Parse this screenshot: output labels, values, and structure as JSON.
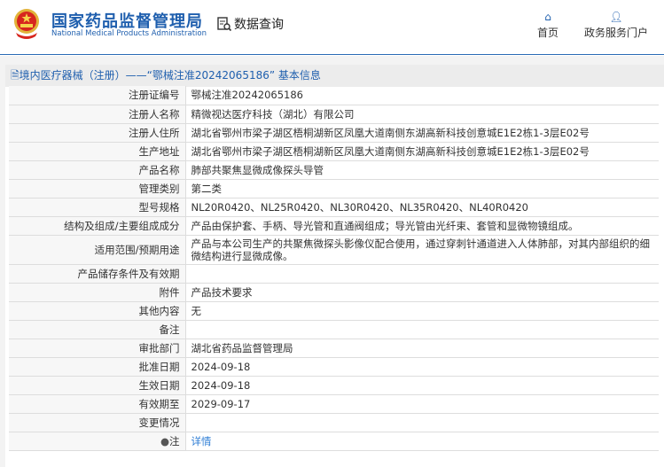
{
  "header": {
    "title_cn": "国家药品监督管理局",
    "title_en": "National Medical Products Administration",
    "query": "数据查询",
    "nav": [
      {
        "label": "首页",
        "icon": "home-icon"
      },
      {
        "label": "政务服务门户",
        "icon": "user-icon"
      }
    ]
  },
  "panel_title": "境内医疗器械（注册）——“鄂械注准20242065186” 基本信息",
  "rows": [
    {
      "label": "注册证编号",
      "value": "鄂械注准20242065186"
    },
    {
      "label": "注册人名称",
      "value": "精微视达医疗科技（湖北）有限公司"
    },
    {
      "label": "注册人住所",
      "value": "湖北省鄂州市梁子湖区梧桐湖新区凤凰大道南侧东湖高新科技创意城E1E2栋1-3层E02号"
    },
    {
      "label": "生产地址",
      "value": "湖北省鄂州市梁子湖区梧桐湖新区凤凰大道南侧东湖高新科技创意城E1E2栋1-3层E02号"
    },
    {
      "label": "产品名称",
      "value": "肺部共聚焦显微成像探头导管"
    },
    {
      "label": "管理类别",
      "value": "第二类"
    },
    {
      "label": "型号规格",
      "value": "NL20R0420、NL25R0420、NL30R0420、NL35R0420、NL40R0420"
    },
    {
      "label": "结构及组成/主要组成成分",
      "value": "产品由保护套、手柄、导光管和直通阀组成；导光管由光纤束、套管和显微物镜组成。"
    },
    {
      "label": "适用范围/预期用途",
      "value": "产品与本公司生产的共聚焦微探头影像仪配合使用，通过穿刺针通道进入人体肺部，对其内部组织的细微结构进行显微成像。"
    },
    {
      "label": "产品储存条件及有效期",
      "value": ""
    },
    {
      "label": "附件",
      "value": "产品技术要求"
    },
    {
      "label": "其他内容",
      "value": "无"
    },
    {
      "label": "备注",
      "value": ""
    },
    {
      "label": "审批部门",
      "value": "湖北省药品监督管理局"
    },
    {
      "label": "批准日期",
      "value": "2024-09-18"
    },
    {
      "label": "生效日期",
      "value": "2024-09-18"
    },
    {
      "label": "有效期至",
      "value": "2029-09-17"
    },
    {
      "label": "变更情况",
      "value": ""
    }
  ],
  "note": {
    "label": "注",
    "link": "详情"
  }
}
